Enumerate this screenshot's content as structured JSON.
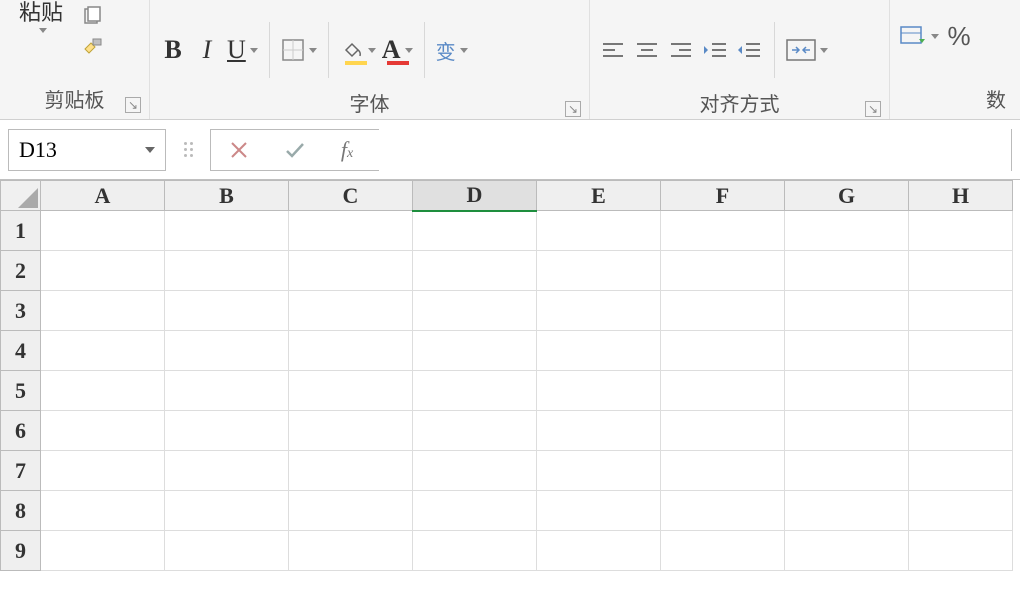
{
  "ribbon": {
    "clipboard": {
      "paste_label": "粘贴",
      "group_label": "剪贴板"
    },
    "font": {
      "bold": "B",
      "italic": "I",
      "underline": "U",
      "fill_letter": "A",
      "color_letter": "A",
      "fill_color": "#ffd54f",
      "text_color": "#e53935",
      "ruby_char": "变",
      "group_label": "字体"
    },
    "align": {
      "group_label": "对齐方式"
    },
    "number": {
      "group_label": "数",
      "percent": "%"
    }
  },
  "formula_bar": {
    "name_box": "D13",
    "fx_label": "f",
    "fx_sub": "x",
    "formula_value": ""
  },
  "grid": {
    "columns": [
      "A",
      "B",
      "C",
      "D",
      "E",
      "F",
      "G",
      "H"
    ],
    "rows": [
      "1",
      "2",
      "3",
      "4",
      "5",
      "6",
      "7",
      "8",
      "9"
    ],
    "selected_col": "D"
  }
}
